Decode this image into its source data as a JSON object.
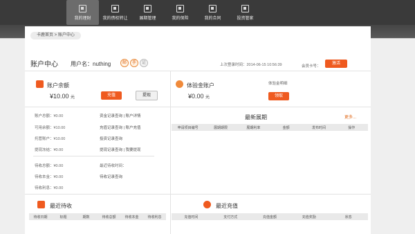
{
  "nav": [
    {
      "label": "我的理财",
      "active": true
    },
    {
      "label": "我的债权转让",
      "active": false
    },
    {
      "label": "展期管理",
      "active": false
    },
    {
      "label": "我的保险",
      "active": false
    },
    {
      "label": "我的合同",
      "active": false
    },
    {
      "label": "投资管家",
      "active": false
    }
  ],
  "breadcrumb": "卡鹿首页 > 账户中心",
  "header": {
    "title": "账户中心",
    "username": "用户名：nuthing",
    "badges": [
      "邮",
      "手",
      "证"
    ],
    "login_time": "上次登录时间：2014-06-15 10:56:39",
    "member_label": "会员卡号：",
    "activate_label": "激活"
  },
  "balance": {
    "title": "账户余额",
    "amount": "¥10.00",
    "unit": "元",
    "recharge_label": "充值",
    "withdraw_label": "提现"
  },
  "trial": {
    "title": "体验金账户",
    "amount": "¥0.00",
    "unit": "元",
    "detail_label": "体验金明细",
    "receive_label": "领取"
  },
  "stats": {
    "total": "账户总额：¥0.00",
    "available": "可用余额：¥10.00",
    "custody": "托管账户：¥10.00",
    "frozen": "提现冻结：¥0.00",
    "due_total": "待收总额：¥0.00",
    "due_principal": "待收本金：¥0.00",
    "due_interest": "待收利息：¥0.00"
  },
  "links": {
    "l1": "资金记录查询 | 账户详情",
    "l2": "充值记录查询 | 账户充值",
    "l3": "投资记录查询",
    "l4": "提现记录查询 | 我要提现",
    "l5": "最近待收时间：",
    "l6": "待收记录查询"
  },
  "extensions": {
    "title": "最新展期",
    "more": "更多...",
    "columns": [
      "申请项目编号",
      "展期期限",
      "展期利率",
      "金额",
      "发布时间",
      "操作"
    ]
  },
  "recent_due": {
    "title": "最近待收",
    "columns": [
      "待收日期",
      "标题",
      "期数",
      "待收总额",
      "待收本金",
      "待收利息"
    ]
  },
  "recent_recharge": {
    "title": "最近充值",
    "columns": [
      "充值时间",
      "支付方式",
      "充值金额",
      "充值奖励",
      "状态"
    ]
  }
}
